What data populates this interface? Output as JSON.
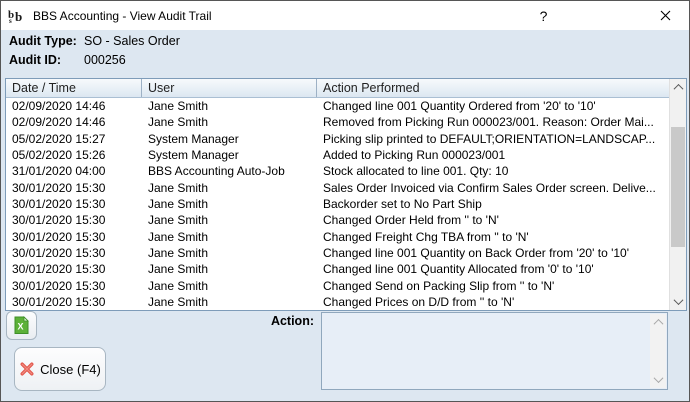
{
  "window": {
    "title": "BBS Accounting - View Audit Trail",
    "help_label": "?",
    "app_icon": "bbs-logo-icon",
    "close_icon": "window-close-icon"
  },
  "info": {
    "audit_type_label": "Audit Type:",
    "audit_type_value": "SO - Sales Order",
    "audit_id_label": "Audit ID:",
    "audit_id_value": "000256"
  },
  "table": {
    "columns": [
      "Date / Time",
      "User",
      "Action Performed"
    ],
    "rows": [
      {
        "datetime": "02/09/2020 14:46",
        "user": "Jane Smith",
        "action": "Changed line 001 Quantity Ordered from '20' to '10'"
      },
      {
        "datetime": "02/09/2020 14:46",
        "user": "Jane Smith",
        "action": "Removed from Picking Run 000023/001. Reason: Order Mai..."
      },
      {
        "datetime": "05/02/2020 15:27",
        "user": "System Manager",
        "action": "Picking slip printed to DEFAULT;ORIENTATION=LANDSCAP..."
      },
      {
        "datetime": "05/02/2020 15:26",
        "user": "System Manager",
        "action": "Added to Picking Run 000023/001"
      },
      {
        "datetime": "31/01/2020 04:00",
        "user": "BBS Accounting Auto-Job",
        "action": "Stock allocated to line 001. Qty: 10"
      },
      {
        "datetime": "30/01/2020 15:30",
        "user": "Jane Smith",
        "action": "Sales Order Invoiced via Confirm Sales Order screen. Delive..."
      },
      {
        "datetime": "30/01/2020 15:30",
        "user": "Jane Smith",
        "action": "Backorder set to No Part Ship"
      },
      {
        "datetime": "30/01/2020 15:30",
        "user": "Jane Smith",
        "action": "Changed Order Held from '' to 'N'"
      },
      {
        "datetime": "30/01/2020 15:30",
        "user": "Jane Smith",
        "action": "Changed Freight Chg TBA from '' to 'N'"
      },
      {
        "datetime": "30/01/2020 15:30",
        "user": "Jane Smith",
        "action": "Changed line 001 Quantity on Back Order from '20' to '10'"
      },
      {
        "datetime": "30/01/2020 15:30",
        "user": "Jane Smith",
        "action": "Changed line 001 Quantity Allocated from '0' to '10'"
      },
      {
        "datetime": "30/01/2020 15:30",
        "user": "Jane Smith",
        "action": "Changed Send on Packing Slip from '' to 'N'"
      },
      {
        "datetime": "30/01/2020 15:30",
        "user": "Jane Smith",
        "action": "Changed Prices on D/D from '' to 'N'"
      }
    ]
  },
  "footer": {
    "action_label": "Action:",
    "action_value": "",
    "close_button_label": "Close (F4)",
    "export_icon": "excel-export-icon",
    "close_icon": "red-x-icon"
  },
  "colors": {
    "dialog_bg": "#dde7f1",
    "titlebar_bg": "#ffffff",
    "table_border": "#7e9cb9",
    "excel_green": "#5cb138",
    "close_x_red": "#e2574c"
  }
}
